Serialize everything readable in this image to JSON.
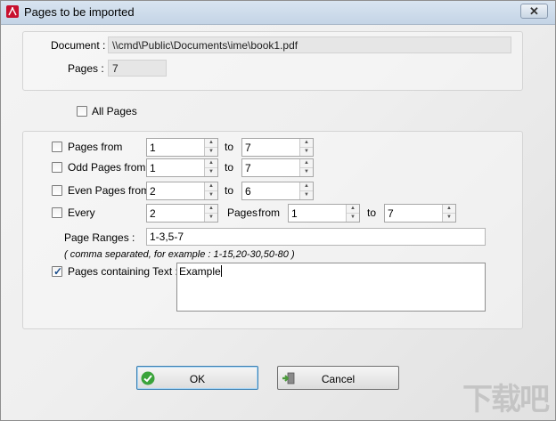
{
  "window": {
    "title": "Pages to be imported",
    "close_glyph": "✕",
    "app_icon": "pdf-icon"
  },
  "info": {
    "document_label": "Document :",
    "document_value": "\\\\cmd\\Public\\Documents\\ime\\book1.pdf",
    "pages_label": "Pages :",
    "pages_value": "7"
  },
  "all_pages": {
    "label": "All Pages",
    "checked": false
  },
  "options": {
    "pages_from": {
      "label": "Pages from",
      "from": "1",
      "to_label": "to",
      "to": "7",
      "checked": false
    },
    "odd_pages_from": {
      "label": "Odd Pages from",
      "from": "1",
      "to_label": "to",
      "to": "7",
      "checked": false
    },
    "even_pages_from": {
      "label": "Even Pages from",
      "from": "2",
      "to_label": "to",
      "to": "6",
      "checked": false
    },
    "every": {
      "label": "Every",
      "value": "2",
      "pages_label": "Pages",
      "from_label": "from",
      "from": "1",
      "to_label": "to",
      "to": "7",
      "checked": false
    },
    "page_ranges": {
      "label": "Page Ranges :",
      "value": "1-3,5-7",
      "hint": "( comma separated, for example : 1-15,20-30,50-80 )"
    },
    "containing_text": {
      "label": "Pages containing Text :",
      "value": "Example",
      "checked": true
    }
  },
  "buttons": {
    "ok": "OK",
    "cancel": "Cancel"
  },
  "watermark": "下载吧",
  "colors": {
    "ok_icon": "#3aa33a",
    "cancel_icon": "#4a9a3a",
    "pdf_red": "#c8102e"
  }
}
